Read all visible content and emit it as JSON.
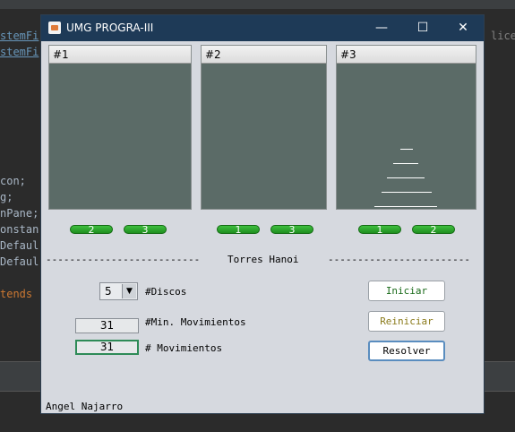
{
  "ide": {
    "code_lines": [
      {
        "text": "stemFi",
        "style": "link"
      },
      {
        "text": "stemFi",
        "style": "link"
      },
      {
        "text": "con;",
        "style": "plain"
      },
      {
        "text": "g;",
        "style": "plain"
      },
      {
        "text": "nPane;",
        "style": "plain"
      },
      {
        "text": "onstan",
        "style": "plain"
      },
      {
        "text": "Defaul",
        "style": "plain"
      },
      {
        "text": "Defaul",
        "style": "plain"
      },
      {
        "text": "tends",
        "style": "kw"
      }
    ],
    "right_text": "lice"
  },
  "window": {
    "title": "UMG PROGRA-III",
    "minimize": "—",
    "maximize": "☐",
    "close": "✕"
  },
  "towers": [
    {
      "label": "#1",
      "disks": []
    },
    {
      "label": "#2",
      "disks": []
    },
    {
      "label": "#3",
      "disks": [
        1,
        2,
        3,
        4,
        5
      ]
    }
  ],
  "move_buttons": [
    {
      "label": "2"
    },
    {
      "label": "3"
    },
    {
      "label": "1"
    },
    {
      "label": "3"
    },
    {
      "label": "1"
    },
    {
      "label": "2"
    }
  ],
  "separator": {
    "left": "--------------------------",
    "title": "Torres Hanoi",
    "right": "------------------------"
  },
  "controls": {
    "discos_value": "5",
    "discos_label": "#Discos",
    "min_mov_value": "31",
    "min_mov_label": "#Min. Movimientos",
    "mov_value": "31",
    "mov_label": "# Movimientos"
  },
  "buttons": {
    "iniciar": "Iniciar",
    "reiniciar": "Reiniciar",
    "resolver": "Resolver"
  },
  "colors": {
    "iniciar_text": "#1a6b1a",
    "reiniciar_text": "#8a7a1a",
    "resolver_text": "#000000"
  },
  "footer": {
    "author": "Angel Najarro"
  }
}
